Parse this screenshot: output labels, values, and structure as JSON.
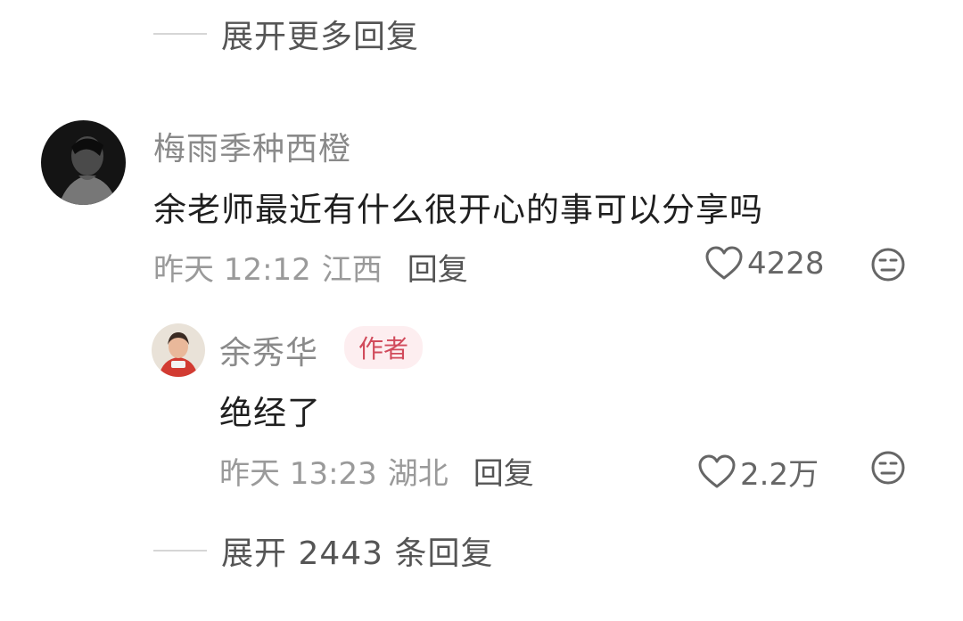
{
  "top_expand": {
    "label": "展开更多回复"
  },
  "comment": {
    "username": "梅雨季种西橙",
    "text": "余老师最近有什么很开心的事可以分享吗",
    "time": "昨天 12:12",
    "location": "江西",
    "reply_label": "回复",
    "likes": "4228"
  },
  "reply": {
    "username": "余秀华",
    "badge": "作者",
    "text": "绝经了",
    "time": "昨天 13:23",
    "location": "湖北",
    "reply_label": "回复",
    "likes": "2.2万"
  },
  "bottom_expand": {
    "label": "展开 2443 条回复"
  },
  "colors": {
    "badge_bg": "#fdeef0",
    "badge_text": "#d14a5b",
    "username": "#8a8a8a",
    "meta": "#9a9a9a"
  },
  "icons": [
    "heart-icon",
    "meh-face-icon"
  ]
}
